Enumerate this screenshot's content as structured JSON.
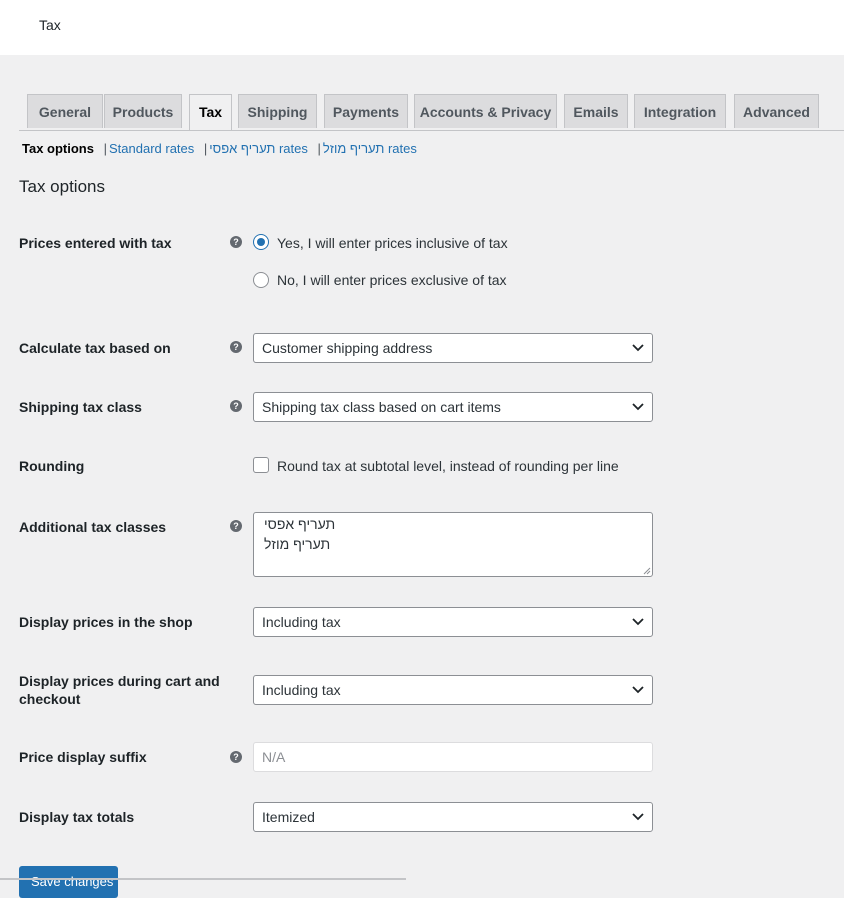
{
  "header": {
    "title": "Tax"
  },
  "tabs": [
    {
      "label": "General",
      "active": false
    },
    {
      "label": "Products",
      "active": false
    },
    {
      "label": "Tax",
      "active": true
    },
    {
      "label": "Shipping",
      "active": false
    },
    {
      "label": "Payments",
      "active": false
    },
    {
      "label": "Accounts & Privacy",
      "active": false
    },
    {
      "label": "Emails",
      "active": false
    },
    {
      "label": "Integration",
      "active": false
    },
    {
      "label": "Advanced",
      "active": false
    }
  ],
  "subnav": {
    "current": "Tax options",
    "links": [
      "Standard rates",
      "תעריף אפסי rates",
      "תעריף מוזל rates"
    ],
    "separator": "|"
  },
  "section_title": "Tax options",
  "fields": {
    "prices_entered_with_tax": {
      "label": "Prices entered with tax",
      "options": [
        {
          "label": "Yes, I will enter prices inclusive of tax",
          "checked": true
        },
        {
          "label": "No, I will enter prices exclusive of tax",
          "checked": false
        }
      ]
    },
    "calculate_tax_based_on": {
      "label": "Calculate tax based on",
      "value": "Customer shipping address"
    },
    "shipping_tax_class": {
      "label": "Shipping tax class",
      "value": "Shipping tax class based on cart items"
    },
    "rounding": {
      "label": "Rounding",
      "checkbox_label": "Round tax at subtotal level, instead of rounding per line",
      "checked": false
    },
    "additional_tax_classes": {
      "label": "Additional tax classes",
      "lines": [
        "תעריף אפסי",
        "תעריף מוזל"
      ]
    },
    "display_prices_shop": {
      "label": "Display prices in the shop",
      "value": "Including tax"
    },
    "display_prices_cart": {
      "label_line1": "Display prices during cart and",
      "label_line2": "checkout",
      "value": "Including tax"
    },
    "price_display_suffix": {
      "label": "Price display suffix",
      "placeholder": "N/A"
    },
    "display_tax_totals": {
      "label": "Display tax totals",
      "value": "Itemized"
    }
  },
  "save_button": {
    "label": "Save changes"
  },
  "colors": {
    "accent": "#2271b1",
    "background": "#f0f0f1",
    "tab_inactive": "#dcdcde"
  },
  "icons": {
    "help": "help-circle-icon",
    "dropdown": "chevron-down-icon"
  }
}
